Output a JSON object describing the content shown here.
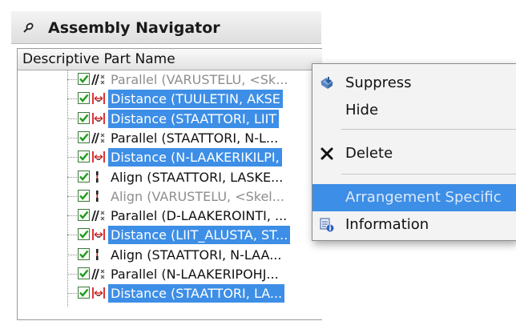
{
  "window": {
    "title": "Assembly Navigator",
    "column_header": "Descriptive Part Name"
  },
  "tree": [
    {
      "icon": "parallel-constraint-icon",
      "text": "Parallel (VARUSTELU, <Sk...",
      "state": "dim"
    },
    {
      "icon": "distance-constraint-icon",
      "text": "Distance (TUULETIN, AKSE",
      "state": "selected"
    },
    {
      "icon": "distance-constraint-icon",
      "text": "Distance (STAATTORI, LIIT",
      "state": "selected"
    },
    {
      "icon": "parallel-constraint-icon",
      "text": "Parallel (STAATTORI, N-L...",
      "state": "normal"
    },
    {
      "icon": "distance-constraint-icon",
      "text": "Distance (N-LAAKERIKILPI,",
      "state": "selected"
    },
    {
      "icon": "align-constraint-icon",
      "text": "Align (STAATTORI, LASKE...",
      "state": "normal"
    },
    {
      "icon": "align-constraint-icon",
      "text": "Align (VARUSTELU, <Skel...",
      "state": "dim"
    },
    {
      "icon": "parallel-constraint-icon",
      "text": "Parallel (D-LAAKEROINTI, ...",
      "state": "normal"
    },
    {
      "icon": "distance-constraint-icon",
      "text": "Distance (LIIT_ALUSTA, ST...",
      "state": "selected"
    },
    {
      "icon": "align-constraint-icon",
      "text": "Align (STAATTORI, N-LAA...",
      "state": "normal"
    },
    {
      "icon": "parallel-constraint-icon",
      "text": "Parallel (N-LAAKERIPOHJ...",
      "state": "normal"
    },
    {
      "icon": "distance-constraint-icon",
      "text": "Distance (STAATTORI, LA...",
      "state": "selected"
    }
  ],
  "context_menu": {
    "items": [
      {
        "label": "Suppress",
        "icon": "suppress-icon",
        "highlighted": false
      },
      {
        "label": "Hide",
        "icon": "",
        "highlighted": false
      },
      {
        "label": "Delete",
        "icon": "delete-x-icon",
        "highlighted": false
      },
      {
        "label": "Arrangement Specific",
        "icon": "",
        "highlighted": true
      },
      {
        "label": "Information",
        "icon": "information-icon",
        "highlighted": false
      }
    ]
  },
  "colors": {
    "selection": "#3d8ee6",
    "checkbox_check": "#1e9b1e",
    "distance_icon_red": "#d42020",
    "dim_text": "#8e8e8e"
  }
}
